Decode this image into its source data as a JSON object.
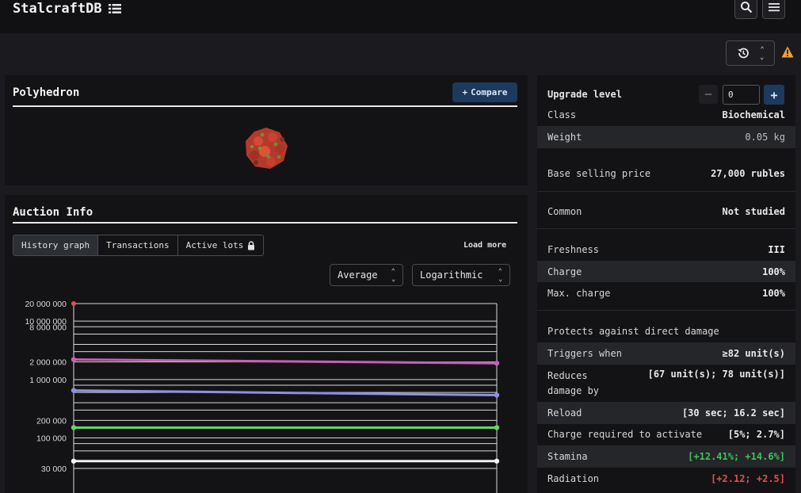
{
  "app": {
    "title": "StalcraftDB"
  },
  "item": {
    "name": "Polyhedron",
    "compare_label": "Compare"
  },
  "auction": {
    "title": "Auction Info",
    "tabs": [
      {
        "label": "History graph",
        "active": true
      },
      {
        "label": "Transactions",
        "active": false
      },
      {
        "label": "Active lots",
        "active": false,
        "icon": "lock-icon"
      }
    ],
    "load_more": "Load more",
    "aggregate_select": "Average",
    "scale_select": "Logarithmic"
  },
  "chart_data": {
    "type": "line",
    "scale": "log",
    "ylim": [
      30000,
      20000000
    ],
    "y_ticks": [
      {
        "value": 20000000,
        "label": "20 000 000"
      },
      {
        "value": 10000000,
        "label": "10 000 000"
      },
      {
        "value": 8000000,
        "label": "8 000 000"
      },
      {
        "value": 2000000,
        "label": "2 000 000"
      },
      {
        "value": 1000000,
        "label": "1 000 000"
      },
      {
        "value": 200000,
        "label": "200 000"
      },
      {
        "value": 100000,
        "label": "100 000"
      },
      {
        "value": 30000,
        "label": "30 000"
      }
    ],
    "grid_values": [
      20000000,
      10000000,
      8000000,
      6000000,
      4000000,
      3000000,
      2000000,
      1000000,
      800000,
      600000,
      400000,
      300000,
      200000,
      100000,
      80000,
      60000,
      40000,
      30000
    ],
    "series": [
      {
        "values": [
          20000000
        ],
        "color": "#e0504f",
        "single": true
      },
      {
        "values": [
          2200000,
          1900000
        ],
        "color": "#c85fb6"
      },
      {
        "values": [
          650000,
          540000
        ],
        "color": "#8f8fe6"
      },
      {
        "values": [
          150000,
          150000
        ],
        "color": "#67d46a"
      },
      {
        "values": [
          40000,
          40000
        ],
        "color": "#f2f2f2"
      }
    ]
  },
  "upgrade": {
    "label": "Upgrade level",
    "value": "0"
  },
  "stats": [
    {
      "label": "Class",
      "value": "Biochemical"
    },
    {
      "label": "Weight",
      "value": "0.05 kg"
    },
    {
      "label": "Base selling price",
      "value": "27,000 rubles"
    },
    {
      "label": "Common",
      "value": "Not studied"
    },
    {
      "label": "Freshness",
      "value": "III"
    },
    {
      "label": "Charge",
      "value": "100%"
    },
    {
      "label": "Max. charge",
      "value": "100%"
    },
    {
      "label": "Protects against direct damage",
      "value": ""
    },
    {
      "label": "Triggers when",
      "value": "≥82 unit(s)"
    },
    {
      "label": "Reduces damage by",
      "value": "[67 unit(s); 78 unit(s)]"
    },
    {
      "label": "Reload",
      "value": "[30 sec; 16.2 sec]"
    },
    {
      "label": "Charge required to activate",
      "value": "[5%; 2.7%]"
    },
    {
      "label": "Stamina",
      "value": "[+12.41%; +14.6%]"
    },
    {
      "label": "Radiation",
      "value": "[+2.12; +2.5]"
    }
  ]
}
